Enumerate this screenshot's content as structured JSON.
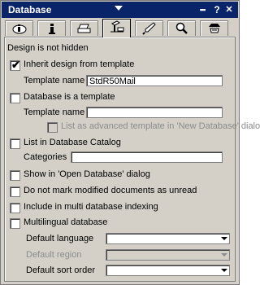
{
  "titlebar": {
    "title": "Database",
    "menu_glyph": "▪▪▪",
    "help_glyph": "?",
    "close_glyph": "✕"
  },
  "tabs": [
    {
      "icon": "info-cloud-icon"
    },
    {
      "icon": "info-icon"
    },
    {
      "icon": "printer-icon"
    },
    {
      "icon": "design-tools-icon"
    },
    {
      "icon": "rocket-icon"
    },
    {
      "icon": "search-icon"
    },
    {
      "icon": "key-hat-icon"
    }
  ],
  "panel": {
    "status_text": "Design is not hidden",
    "inherit_design": {
      "label": "Inherit design from template",
      "checked": true
    },
    "template_name_label": "Template name",
    "template_name_value": "StdR50Mail",
    "is_template": {
      "label": "Database is a template",
      "checked": false
    },
    "template_name2_label": "Template name",
    "template_name2_value": "",
    "advanced_template": {
      "label": "List as advanced template in 'New Database' dialog",
      "checked": false
    },
    "catalog": {
      "label": "List in Database Catalog",
      "checked": false
    },
    "categories_label": "Categories",
    "categories_value": "",
    "show_open_db": {
      "label": "Show in 'Open Database' dialog",
      "checked": false
    },
    "no_unread": {
      "label": "Do not mark modified documents as unread",
      "checked": false
    },
    "multi_index": {
      "label": "Include in multi database indexing",
      "checked": false
    },
    "multilingual": {
      "label": "Multilingual database",
      "checked": false
    },
    "default_language_label": "Default language",
    "default_language_value": "",
    "default_region_label": "Default region",
    "default_region_value": "",
    "default_sort_label": "Default sort order",
    "default_sort_value": ""
  }
}
